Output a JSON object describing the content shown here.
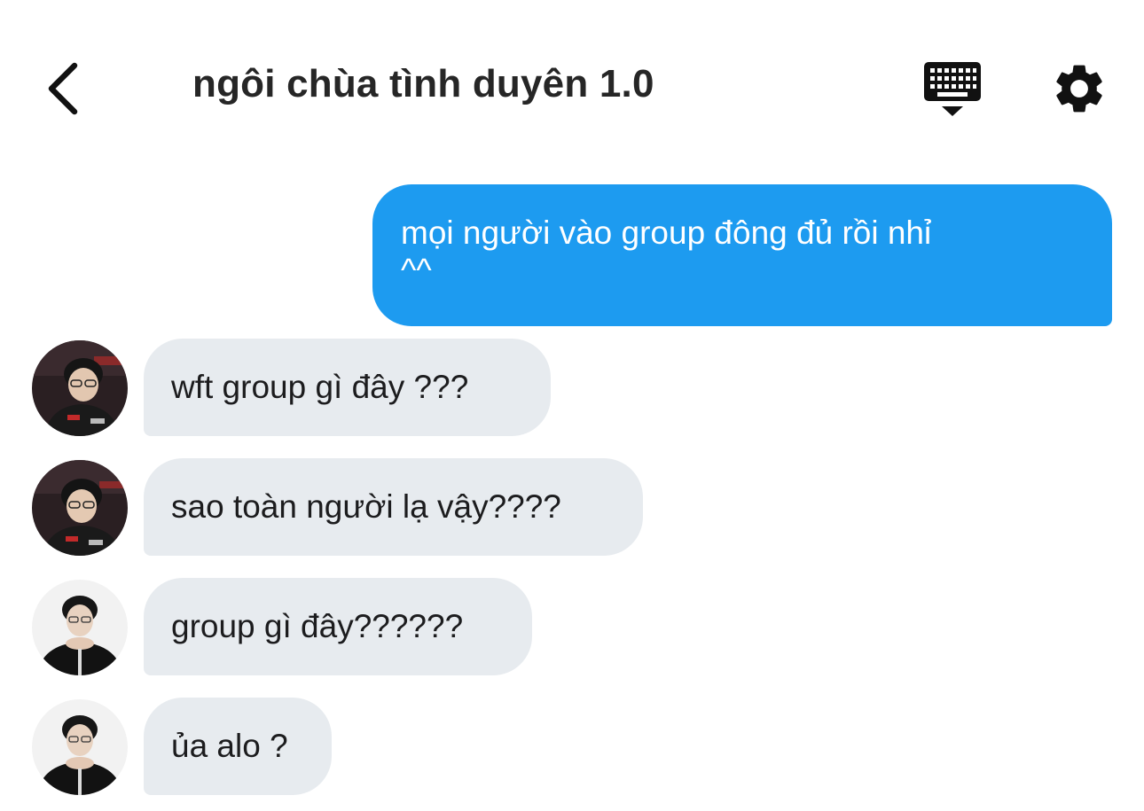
{
  "header": {
    "title": "ngôi chùa tình duyên 1.0",
    "back_icon": "chevron-left-icon",
    "keyboard_icon": "keyboard-icon",
    "settings_icon": "gear-icon"
  },
  "messages": [
    {
      "direction": "outgoing",
      "lines": [
        "mọi người vào group đông đủ rồi nhỉ",
        "^^"
      ]
    },
    {
      "direction": "incoming",
      "text": "wft group gì đây ???",
      "avatar": "user-avatar-glasses"
    },
    {
      "direction": "incoming",
      "text": "sao toàn người lạ vậy????",
      "avatar": "user-avatar-glasses"
    },
    {
      "direction": "incoming",
      "text": "group gì đây??????",
      "avatar": "user-avatar-black-shirt"
    },
    {
      "direction": "incoming",
      "text": "ủa alo ?",
      "avatar": "user-avatar-black-shirt"
    }
  ],
  "colors": {
    "outgoing_bubble": "#1d9bf0",
    "incoming_bubble": "#e7ebef",
    "icon": "#111111"
  }
}
